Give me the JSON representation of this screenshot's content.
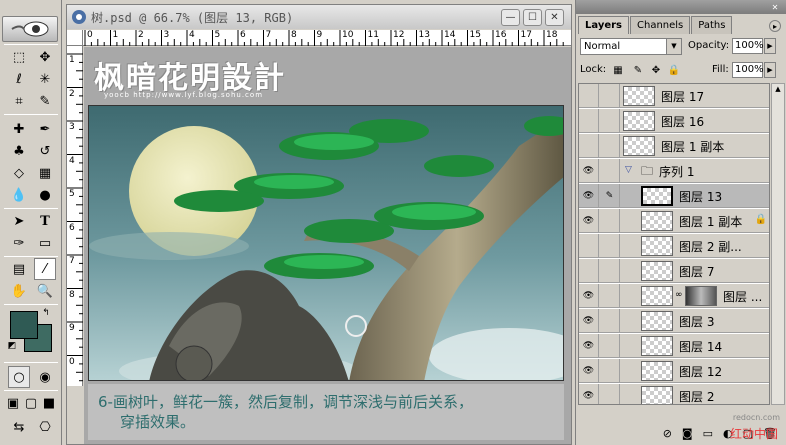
{
  "document": {
    "title": "树.psd @ 66.7% (图层 13, RGB)",
    "ruler_top_labels": [
      "0",
      "1",
      "2",
      "3",
      "4",
      "5",
      "6",
      "7",
      "8",
      "9",
      "10",
      "11",
      "12",
      "13",
      "14",
      "15",
      "16",
      "17",
      "18"
    ],
    "ruler_left_labels": [
      "1",
      "2",
      "3",
      "4",
      "5",
      "6",
      "7",
      "8",
      "9",
      "0"
    ],
    "watermark_logo": "枫暗花明設計",
    "watermark_sub": "yoocb   http://www.lyf.blog.sohu.com",
    "caption_line1": "6-画树叶，鲜花一簇，然后复制，调节深浅与前后关系，",
    "caption_line2": "穿插效果。"
  },
  "layers_panel": {
    "tabs": [
      "Layers",
      "Channels",
      "Paths"
    ],
    "blend_mode": "Normal",
    "opacity_label": "Opacity:",
    "opacity_value": "100%",
    "lock_label": "Lock:",
    "fill_label": "Fill:",
    "fill_value": "100%",
    "layers": [
      {
        "name": "图层 17",
        "visible": false
      },
      {
        "name": "图层 16",
        "visible": false
      },
      {
        "name": "图层 1 副本",
        "visible": false
      },
      {
        "name": "序列 1",
        "visible": true,
        "group": true
      },
      {
        "name": "图层 13",
        "visible": true,
        "selected": true
      },
      {
        "name": "图层 1 副本",
        "visible": true,
        "locked": true
      },
      {
        "name": "图层 2 副...",
        "visible": false
      },
      {
        "name": "图层 7",
        "visible": false
      },
      {
        "name": "图层 ...",
        "visible": true,
        "mask": true
      },
      {
        "name": "图层 3",
        "visible": true
      },
      {
        "name": "图层 14",
        "visible": true
      },
      {
        "name": "图层 12",
        "visible": true
      },
      {
        "name": "图层 2",
        "visible": true
      }
    ]
  },
  "site_watermark": "redocn.com",
  "site_watermark2": "红动中国",
  "colors": {
    "foreground": "#2f5a54",
    "background": "#3e6b62",
    "caption_text": "#2e6e6e"
  }
}
